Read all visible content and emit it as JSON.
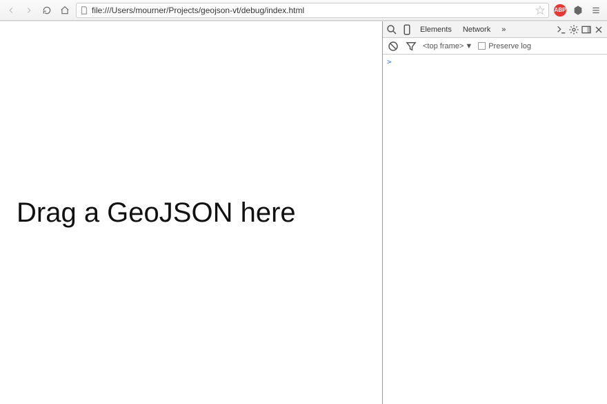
{
  "toolbar": {
    "url": "file:///Users/mourner/Projects/geojson-vt/debug/index.html",
    "abp_label": "ABP"
  },
  "page": {
    "message": "Drag a GeoJSON here"
  },
  "devtools": {
    "tabs": {
      "elements": "Elements",
      "network": "Network",
      "more": "»"
    },
    "sub": {
      "frame_label": "<top frame>",
      "preserve_label": "Preserve log"
    },
    "console": {
      "prompt": ">"
    }
  }
}
